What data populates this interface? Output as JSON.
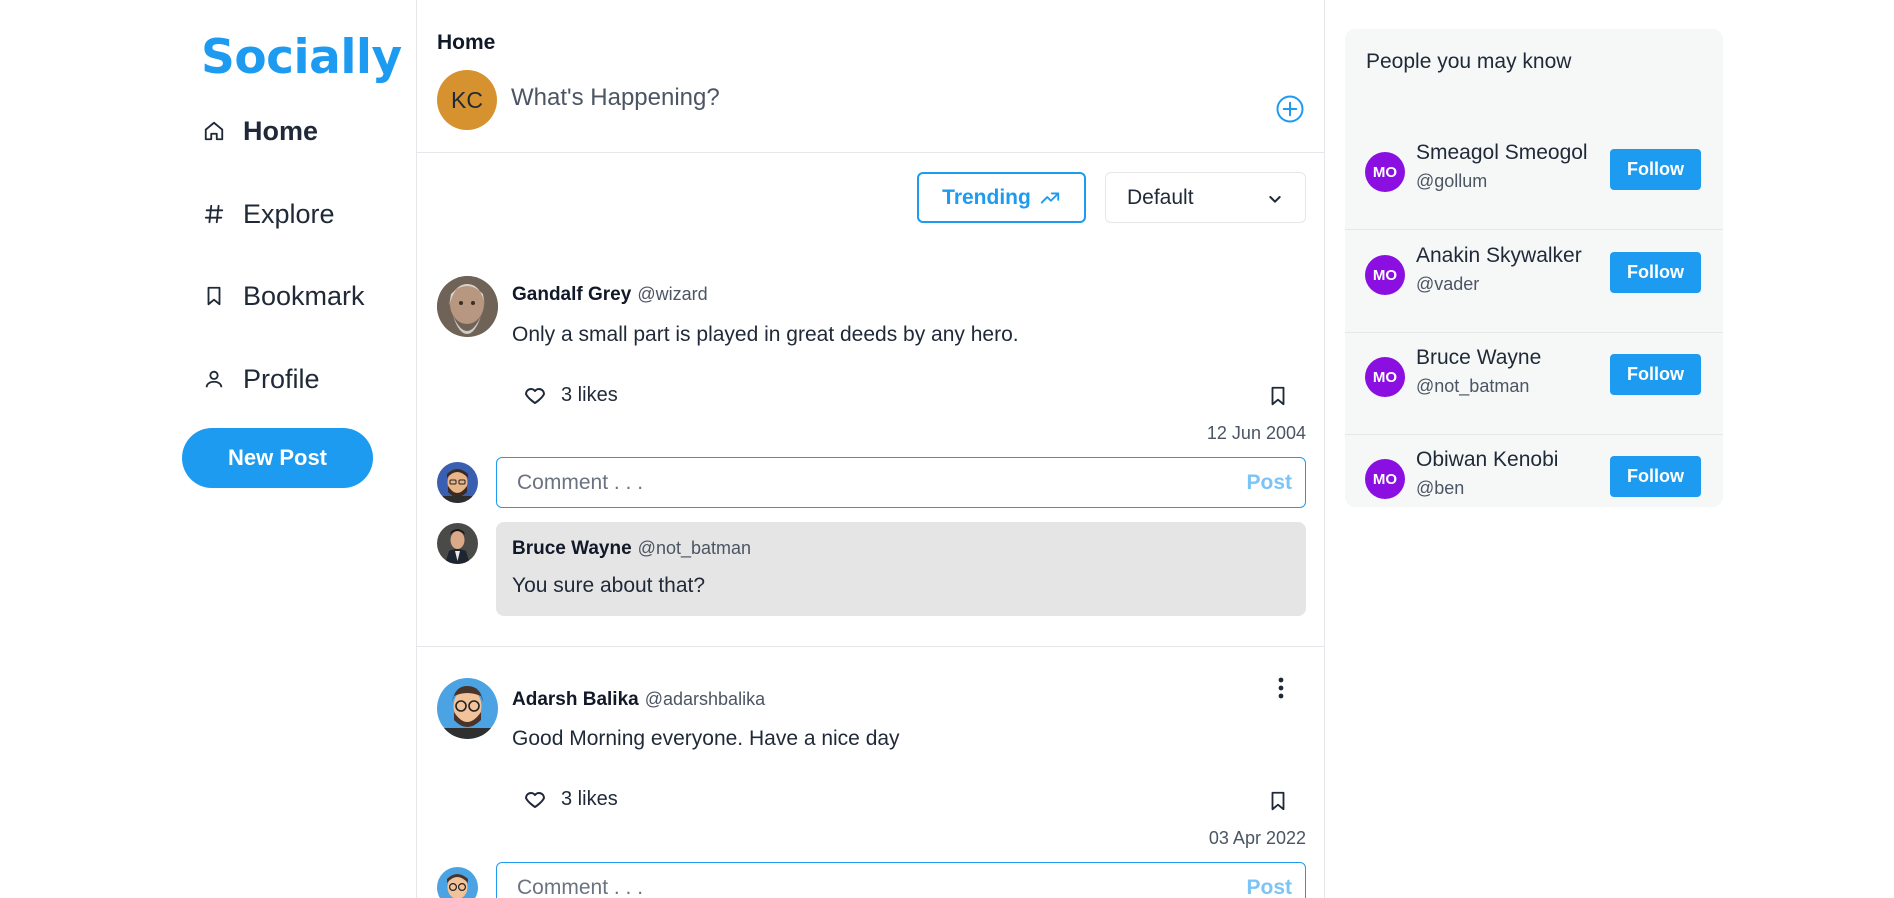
{
  "brand": {
    "name": "Socially",
    "accent": "#1d9bf0"
  },
  "nav": {
    "items": [
      {
        "label": "Home",
        "icon": "home-icon"
      },
      {
        "label": "Explore",
        "icon": "hash-icon"
      },
      {
        "label": "Bookmark",
        "icon": "bookmark-icon"
      },
      {
        "label": "Profile",
        "icon": "user-icon"
      }
    ],
    "new_post_label": "New Post"
  },
  "main": {
    "title": "Home",
    "composer": {
      "avatar_initials": "KC",
      "placeholder": "What's Happening?"
    },
    "filters": {
      "trending_label": "Trending",
      "sort_selected": "Default"
    },
    "posts": [
      {
        "name": "Gandalf Grey",
        "handle": "@wizard",
        "text": "Only a small part is played in great deeds by any hero.",
        "likes": "3 likes",
        "date": "12 Jun 2004",
        "comment_placeholder": "Comment . . .",
        "comment_post_label": "Post",
        "replies": [
          {
            "name": "Bruce Wayne",
            "handle": "@not_batman",
            "text": "You sure about that?"
          }
        ]
      },
      {
        "name": "Adarsh Balika",
        "handle": "@adarshbalika",
        "text": "Good Morning everyone. Have a nice day",
        "likes": "3 likes",
        "date": "03 Apr 2022",
        "comment_placeholder": "Comment . . .",
        "comment_post_label": "Post"
      }
    ]
  },
  "suggestions": {
    "title": "People you may know",
    "people": [
      {
        "initials": "MO",
        "name": "Smeagol Smeogol",
        "handle": "@gollum",
        "follow_label": "Follow"
      },
      {
        "initials": "MO",
        "name": "Anakin Skywalker",
        "handle": "@vader",
        "follow_label": "Follow"
      },
      {
        "initials": "MO",
        "name": "Bruce Wayne",
        "handle": "@not_batman",
        "follow_label": "Follow"
      },
      {
        "initials": "MO",
        "name": "Obiwan Kenobi",
        "handle": "@ben",
        "follow_label": "Follow"
      }
    ]
  }
}
